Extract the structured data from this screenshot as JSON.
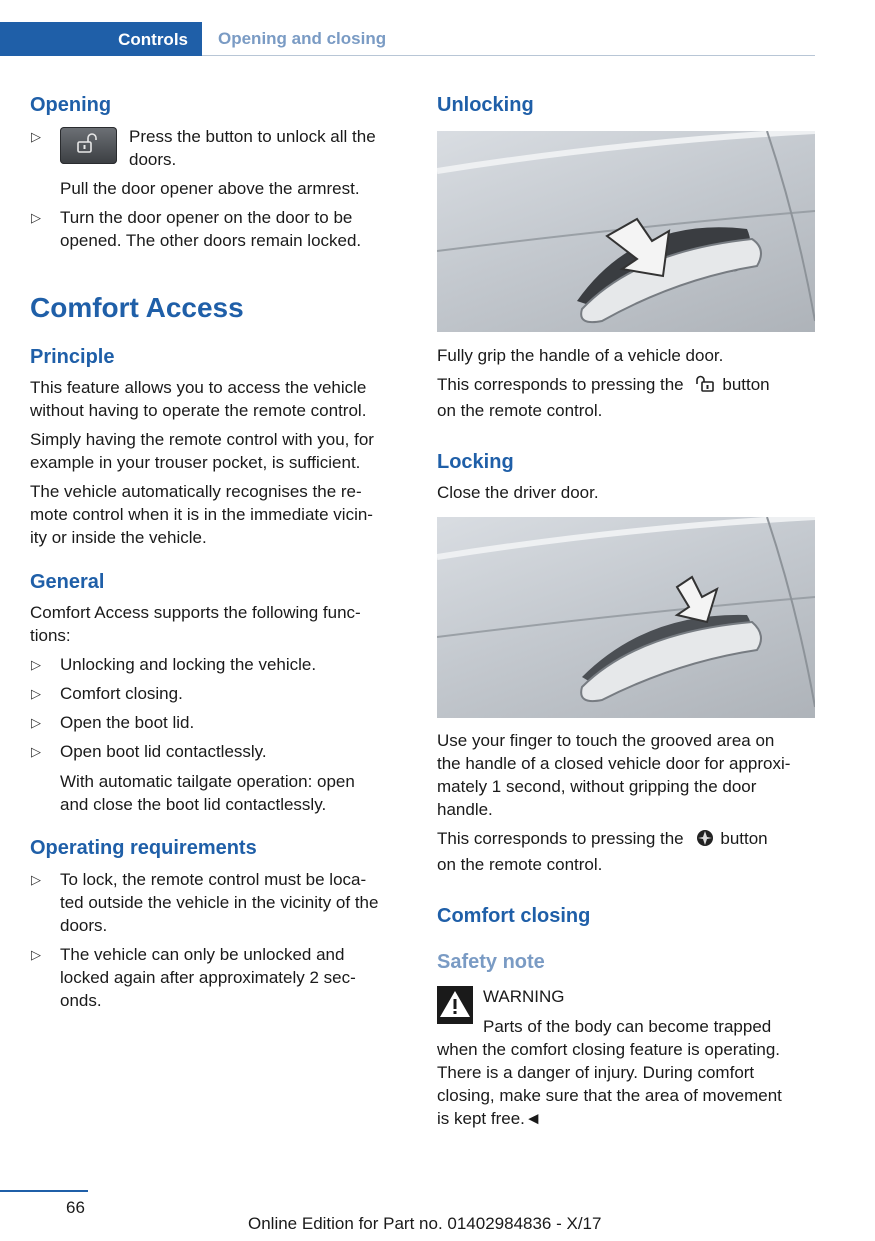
{
  "header": {
    "chapter": "Controls",
    "section": "Opening and closing"
  },
  "left": {
    "opening": {
      "heading": "Opening",
      "b1_line1": "Press the button to unlock all the",
      "b1_line2": "doors.",
      "b1_sub": "Pull the door opener above the armrest.",
      "b2_line1": "Turn the door opener on the door to be",
      "b2_line2": "opened. The other doors remain locked."
    },
    "comfort": {
      "heading": "Comfort Access",
      "principle": "Principle",
      "p1": [
        "This feature allows you to access the vehicle",
        "without having to operate the remote control."
      ],
      "p2": [
        "Simply having the remote control with you, for",
        "example in your trouser pocket, is sufficient."
      ],
      "p3": [
        "The vehicle automatically recognises the re-",
        "mote control when it is in the immediate vicin-",
        "ity or inside the vehicle."
      ],
      "general": "General",
      "g_intro": [
        "Comfort Access supports the following func-",
        "tions:"
      ],
      "g_items": [
        "Unlocking and locking the vehicle.",
        "Comfort closing.",
        "Open the boot lid.",
        "Open boot lid contactlessly."
      ],
      "g_sub": [
        "With automatic tailgate operation: open",
        "and close the boot lid contactlessly."
      ],
      "opreq": "Operating requirements",
      "r1": [
        "To lock, the remote control must be loca-",
        "ted outside the vehicle in the vicinity of the",
        "doors."
      ],
      "r2": [
        "The vehicle can only be unlocked and",
        "locked again after approximately 2 sec-",
        "onds."
      ]
    }
  },
  "right": {
    "unlocking": {
      "heading": "Unlocking",
      "t1": "Fully grip the handle of a vehicle door.",
      "t2a": "This corresponds to pressing the",
      "t2b": "button",
      "t2c": "on the remote control."
    },
    "locking": {
      "heading": "Locking",
      "t1": "Close the driver door.",
      "t2": [
        "Use your finger to touch the grooved area on",
        "the handle of a closed vehicle door for approxi-",
        "mately 1 second, without gripping the door",
        "handle."
      ],
      "t3a": "This corresponds to pressing the",
      "t3b": "button",
      "t3c": "on the remote control."
    },
    "comfort_closing": {
      "heading": "Comfort closing",
      "safety": "Safety note",
      "warning": "WARNING",
      "w1": "Parts of the body can become trapped",
      "w2": [
        "when the comfort closing feature is operating.",
        "There is a danger of injury. During comfort",
        "closing, make sure that the area of movement",
        "is kept free.◄"
      ]
    }
  },
  "footer": {
    "page": "66",
    "edition": "Online Edition for Part no. 01402984836 - X/17"
  },
  "colors": {
    "brand_blue": "#1f5fa8",
    "light_blue": "#7a9bc4"
  },
  "icons": [
    "unlock-button-icon",
    "unlock-icon",
    "lock-icon",
    "warning-triangle-icon",
    "bullet-triangle-icon"
  ]
}
